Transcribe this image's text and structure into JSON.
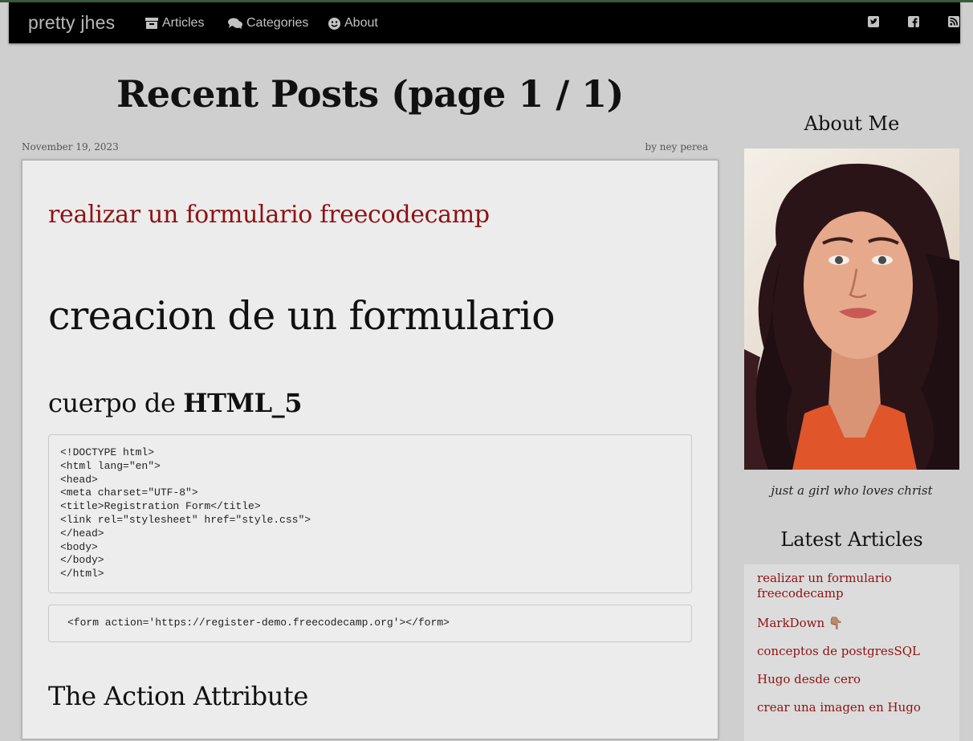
{
  "navbar": {
    "brand": "pretty jhes",
    "items": [
      {
        "label": "Articles",
        "icon": "archive-icon"
      },
      {
        "label": "Categories",
        "icon": "comments-icon"
      },
      {
        "label": "About",
        "icon": "smile-icon"
      }
    ],
    "social": [
      "twitter-icon",
      "facebook-icon",
      "rss-icon"
    ]
  },
  "main": {
    "page_title": "Recent Posts (page 1 / 1)",
    "post": {
      "date": "November 19, 2023",
      "author": "by ney perea",
      "title": "realizar un formulario freecodecamp",
      "h1": "creacion de un formulario",
      "h2_prefix": "cuerpo de ",
      "h2_bold": "HTML_5",
      "code1": "<!DOCTYPE html>\n<html lang=\"en\">\n<head>\n<meta charset=\"UTF-8\">\n<title>Registration Form</title>\n<link rel=\"stylesheet\" href=\"style.css\">\n</head>\n<body>\n</body>\n</html>",
      "code2": "<form action='https://register-demo.freecodecamp.org'></form>",
      "h2_action": "The Action Attribute"
    }
  },
  "sidebar": {
    "about_heading": "About Me",
    "tagline": "just a girl who loves christ",
    "latest_heading": "Latest Articles",
    "latest": [
      "realizar un formulario freecodecamp",
      "MarkDown 👇🏽",
      "conceptos de postgresSQL",
      "Hugo desde cero",
      "crear una imagen en Hugo"
    ]
  },
  "colors": {
    "background": "#cfcfcf",
    "navbar": "#000000",
    "link": "#8e1212",
    "card": "#ececec"
  }
}
